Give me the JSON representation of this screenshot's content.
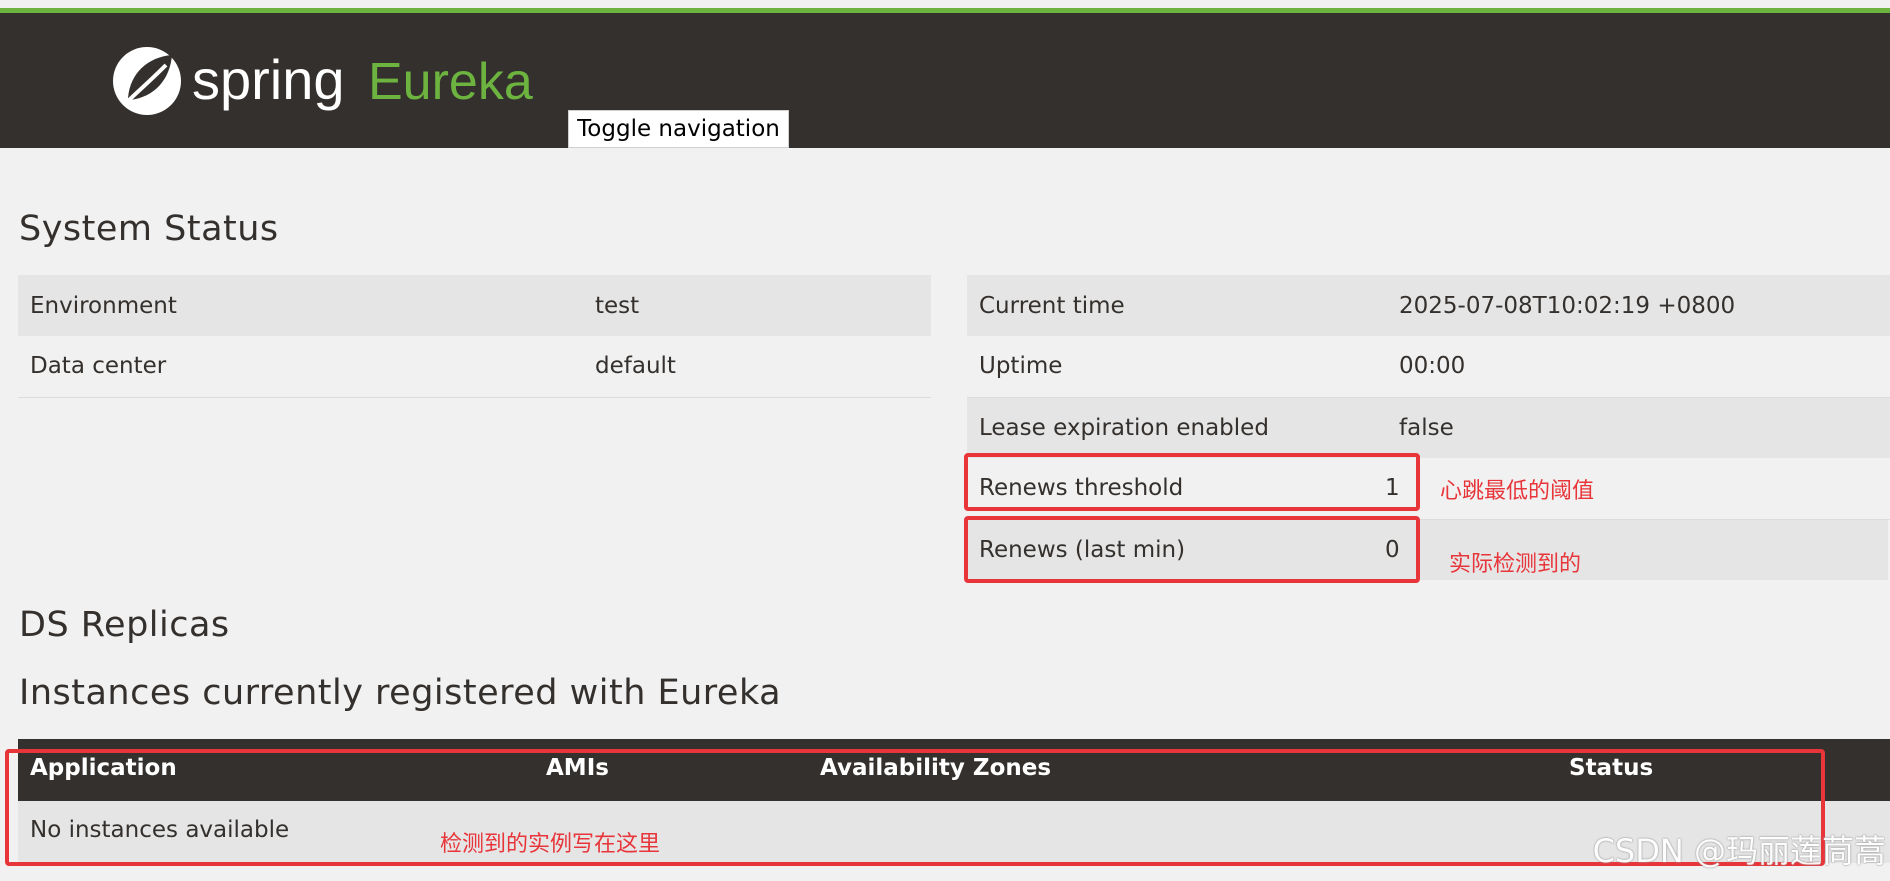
{
  "brand": {
    "logo_text": "spring",
    "product": "Eureka"
  },
  "nav": {
    "toggle_label": "Toggle navigation"
  },
  "system_status": {
    "title": "System Status",
    "left_rows": [
      {
        "label": "Environment",
        "value": "test"
      },
      {
        "label": "Data center",
        "value": "default"
      }
    ],
    "right_rows": [
      {
        "label": "Current time",
        "value": "2025-07-08T10:02:19 +0800"
      },
      {
        "label": "Uptime",
        "value": "00:00"
      },
      {
        "label": "Lease expiration enabled",
        "value": "false"
      },
      {
        "label": "Renews threshold",
        "value": "1"
      },
      {
        "label": "Renews (last min)",
        "value": "0"
      }
    ]
  },
  "ds_replicas": {
    "title": "DS Replicas"
  },
  "instances": {
    "title": "Instances currently registered with Eureka",
    "columns": [
      "Application",
      "AMIs",
      "Availability Zones",
      "Status"
    ],
    "empty_text": "No instances available"
  },
  "annotations": {
    "renews_threshold": "心跳最低的阈值",
    "renews_last_min": "实际检测到的",
    "instances": "检测到的实例写在这里"
  },
  "watermark": "CSDN @玛丽莲茼蒿",
  "colors": {
    "brand_green": "#6db33f",
    "dark": "#34302d",
    "annotation_red": "#e8353a"
  }
}
